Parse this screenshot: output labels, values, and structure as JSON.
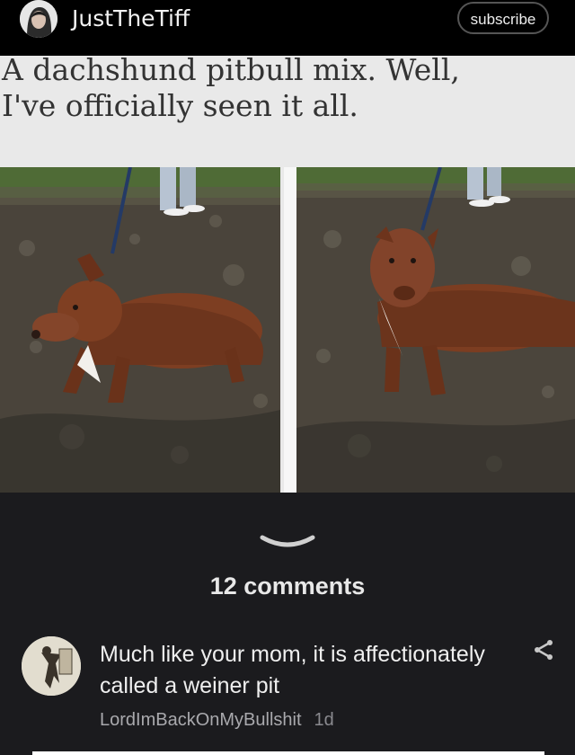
{
  "header": {
    "username": "JustTheTiff",
    "subscribe_label": "subscribe"
  },
  "post": {
    "caption_line1": "A dachshund pitbull mix. Well,",
    "caption_line2": "I've officially seen it all."
  },
  "comments": {
    "count_label": "12 comments",
    "items": [
      {
        "text": "Much like your mom, it is affectionately called a weiner pit",
        "author": "LordImBackOnMyBullshit",
        "time": "1d"
      }
    ]
  },
  "icons": {
    "collapse": "chevron-down-icon",
    "share": "share-icon"
  }
}
